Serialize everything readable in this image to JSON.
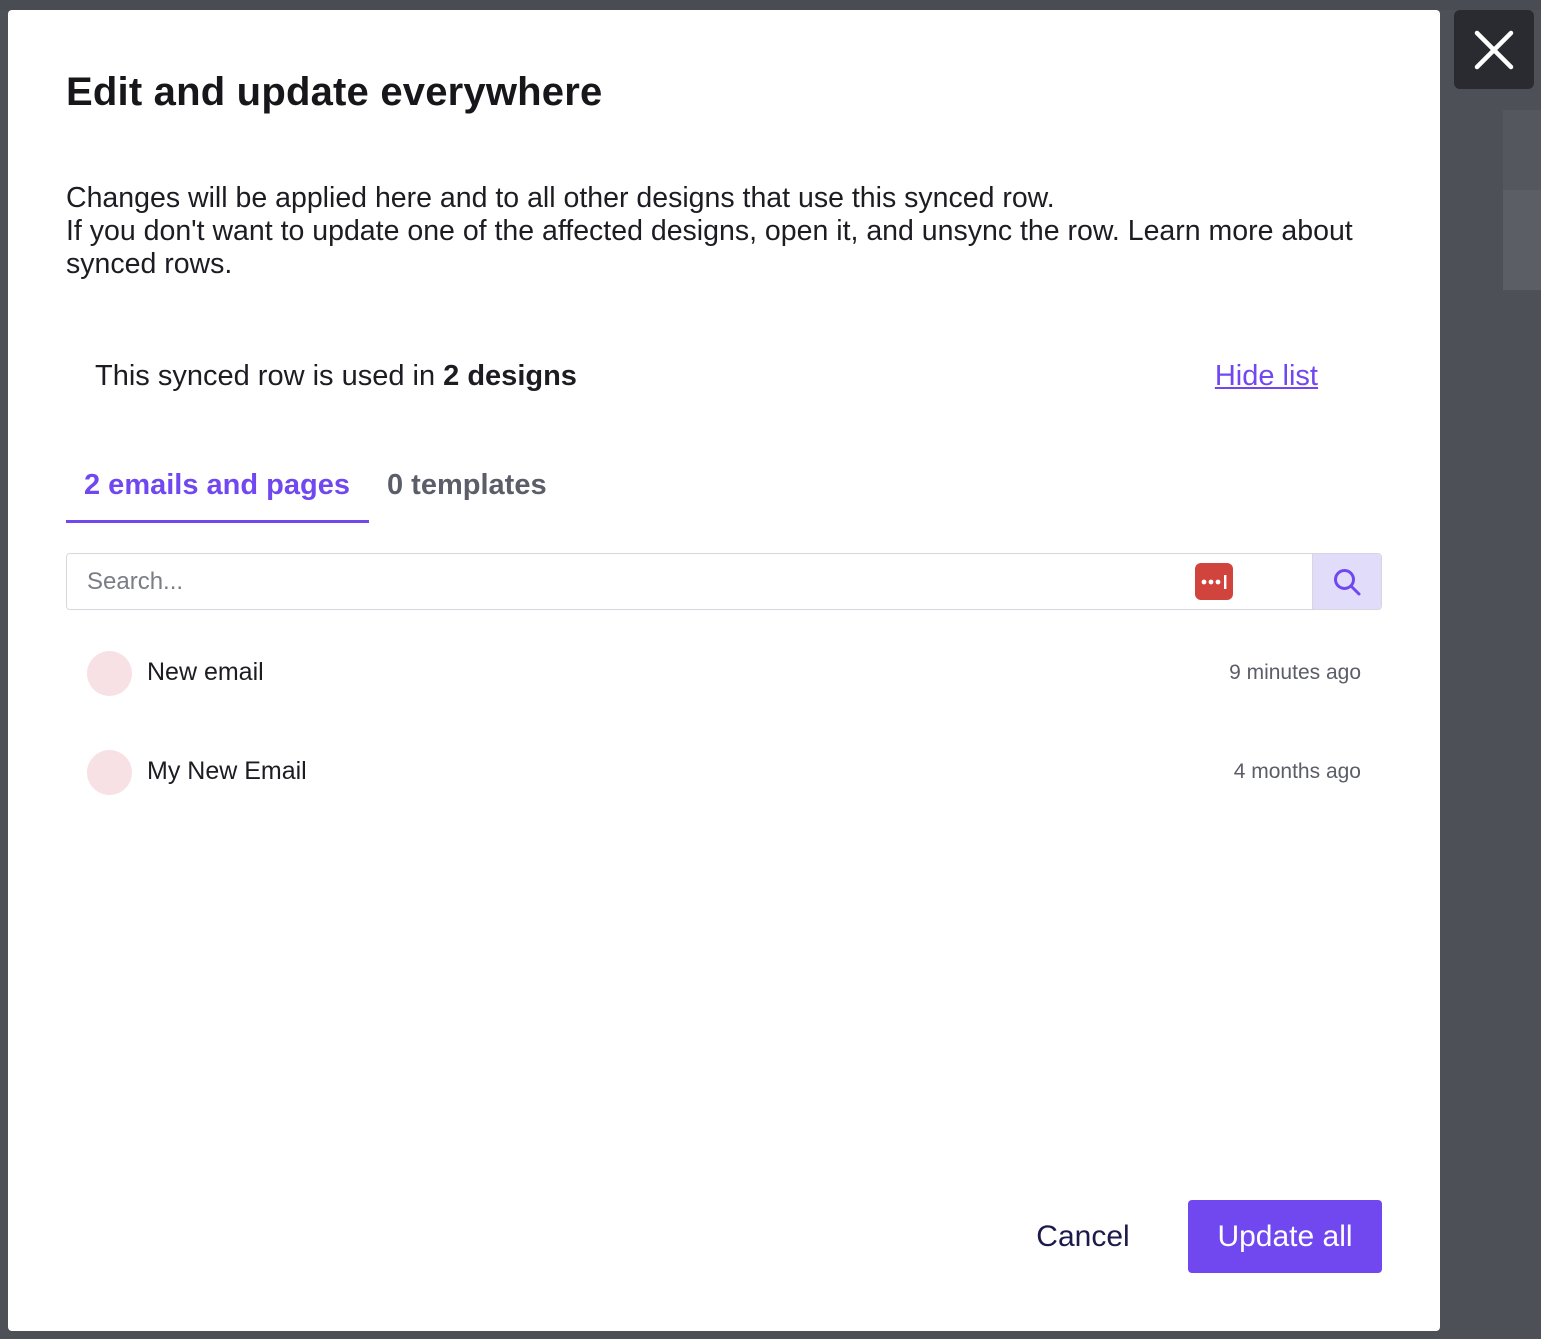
{
  "modal": {
    "title": "Edit and update everywhere",
    "description_line1": "Changes will be applied here and to all other designs that use this synced row.",
    "description_line2": "If you don't want to update one of the affected designs, open it, and unsync the row. Learn more about synced rows.",
    "usage_prefix": "This synced row is used in ",
    "usage_count": "2 designs",
    "hide_list_label": "Hide list"
  },
  "tabs": [
    {
      "label": "2 emails and pages",
      "active": true
    },
    {
      "label": "0 templates",
      "active": false
    }
  ],
  "search": {
    "placeholder": "Search...",
    "value": "",
    "password_manager_icon": "password-dots-icon",
    "button_icon": "search-icon"
  },
  "designs": [
    {
      "name": "New email",
      "updated": "9 minutes ago"
    },
    {
      "name": "My New Email",
      "updated": "4 months ago"
    }
  ],
  "footer": {
    "cancel_label": "Cancel",
    "update_label": "Update all"
  },
  "colors": {
    "accent": "#7148f0",
    "backdrop": "#4e5058",
    "avatar": "#f7e1e4",
    "password_icon": "#d1443d",
    "search_button": "#e2dcfb"
  }
}
